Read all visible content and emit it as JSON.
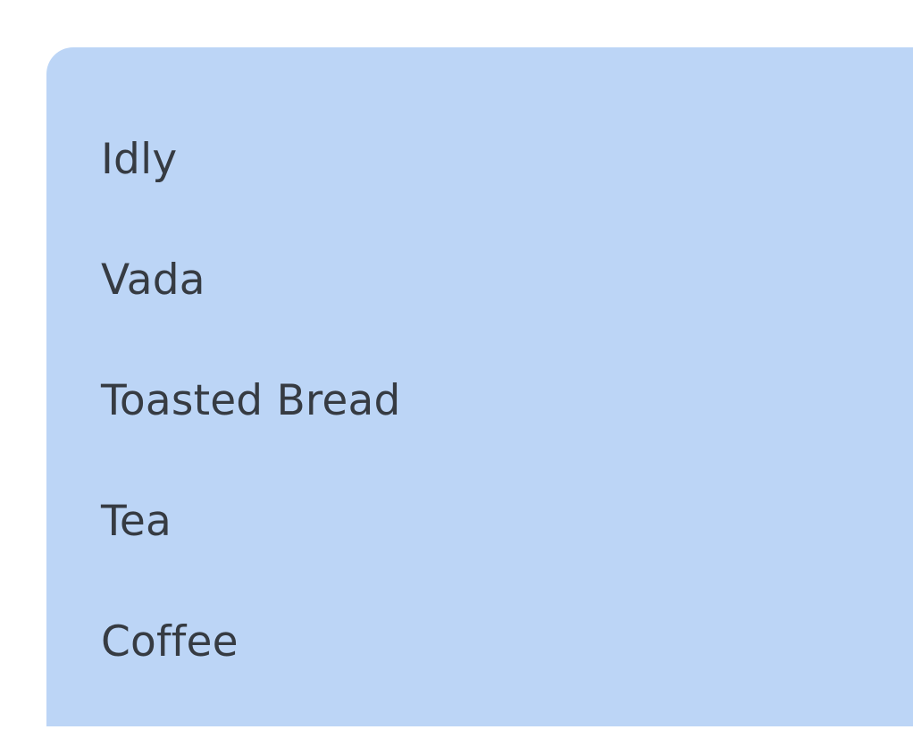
{
  "menu": {
    "items": [
      {
        "label": "Idly"
      },
      {
        "label": "Vada"
      },
      {
        "label": "Toasted Bread"
      },
      {
        "label": "Tea"
      },
      {
        "label": "Coffee"
      }
    ]
  },
  "colors": {
    "card_background": "#bcd5f6",
    "text": "#363b42",
    "page_background": "#ffffff"
  }
}
